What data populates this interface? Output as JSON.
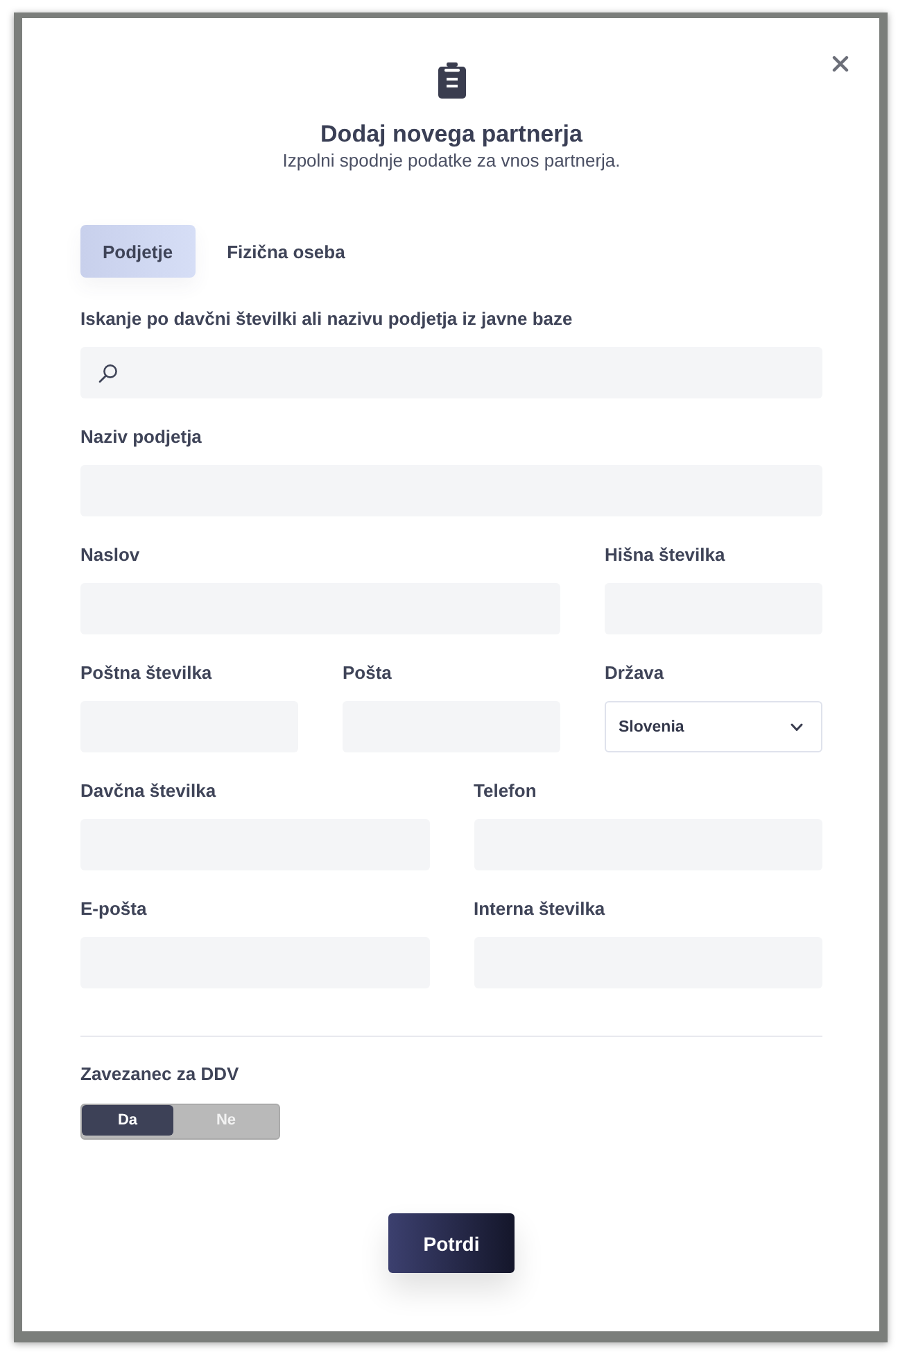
{
  "dialog": {
    "title": "Dodaj novega partnerja",
    "subtitle": "Izpolni spodnje podatke za vnos partnerja."
  },
  "tabs": [
    {
      "label": "Podjetje",
      "selected": true
    },
    {
      "label": "Fizična oseba",
      "selected": false
    }
  ],
  "form_rows": [
    {
      "fields": [
        {
          "kind": "search",
          "label": "Iskanje po davčni številki ali nazivu podjetja iz javne baze"
        }
      ]
    },
    {
      "fields": [
        {
          "kind": "text",
          "label": "Naziv podjetja"
        }
      ]
    },
    {
      "fields": [
        {
          "kind": "text",
          "label": "Naslov"
        },
        {
          "kind": "text",
          "label": "Hišna številka"
        }
      ]
    },
    {
      "fields": [
        {
          "kind": "text",
          "label": "Poštna številka"
        },
        {
          "kind": "text",
          "label": "Pošta"
        },
        {
          "kind": "select",
          "label": "Država",
          "value": "Slovenia"
        }
      ]
    },
    {
      "fields": [
        {
          "kind": "text",
          "label": "Davčna številka"
        },
        {
          "kind": "text",
          "label": "Telefon"
        }
      ]
    },
    {
      "fields": [
        {
          "kind": "text",
          "label": "E-pošta"
        },
        {
          "kind": "text",
          "label": "Interna številka"
        }
      ]
    }
  ],
  "vat": {
    "label": "Zavezanec za DDV",
    "options": [
      {
        "label": "Da",
        "selected": true
      },
      {
        "label": "Ne",
        "selected": false
      }
    ]
  },
  "buttons": [
    "Potrdi"
  ]
}
